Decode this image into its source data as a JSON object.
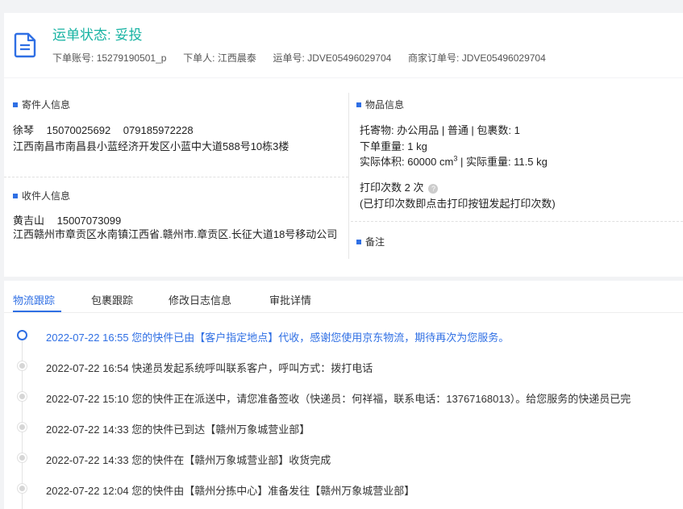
{
  "header": {
    "status_label": "运单状态: 妥投",
    "account_label": "下单账号:",
    "account_value": "15279190501_p",
    "orderer_label": "下单人:",
    "orderer_value": "江西晨泰",
    "waybill_label": "运单号:",
    "waybill_value": "JDVE05496029704",
    "merchant_label": "商家订单号:",
    "merchant_value": "JDVE05496029704",
    "icon": "document-icon"
  },
  "sender": {
    "title": "寄件人信息",
    "name": "徐琴",
    "phone": "15070025692",
    "tel": "079185972228",
    "address": "江西南昌市南昌县小蓝经济开发区小蓝中大道588号10栋3楼"
  },
  "receiver": {
    "title": "收件人信息",
    "name": "黄吉山",
    "phone": "15007073099",
    "address": "江西赣州市章贡区水南镇江西省.赣州市.章贡区.长征大道18号移动公司"
  },
  "goods": {
    "title": "物品信息",
    "line1": "托寄物:  办公用品 | 普通  |  包裹数:  1",
    "weight_line": "下单重量:   1 kg",
    "volume_prefix": "实际体积:    60000 cm",
    "volume_sup": "3",
    "volume_suffix": " | 实际重量:   11.5 kg",
    "print_line": "打印次数    2 次",
    "print_note": "(已打印次数即点击打印按钮发起打印次数)",
    "remark_title": "备注"
  },
  "tabs": [
    "物流跟踪",
    "包裹跟踪",
    "修改日志信息",
    "审批详情"
  ],
  "active_tab": "物流跟踪",
  "tracking": [
    {
      "text": "2022-07-22 16:55 您的快件已由【客户指定地点】代收，感谢您使用京东物流，期待再次为您服务。",
      "active": true
    },
    {
      "text": "2022-07-22 16:54 快递员发起系统呼叫联系客户，呼叫方式：拨打电话",
      "active": false
    },
    {
      "text": "2022-07-22 15:10 您的快件正在派送中，请您准备签收（快递员：何祥福，联系电话：13767168013）。给您服务的快递员已完",
      "active": false
    },
    {
      "text": "2022-07-22 14:33 您的快件已到达【赣州万象城营业部】",
      "active": false
    },
    {
      "text": "2022-07-22 14:33 您的快件在【赣州万象城营业部】收货完成",
      "active": false
    },
    {
      "text": "2022-07-22 12:04 您的快件由【赣州分拣中心】准备发往【赣州万象城营业部】",
      "active": false
    }
  ],
  "colors": {
    "accent": "#2f6fe4",
    "status": "#17b3a3"
  }
}
